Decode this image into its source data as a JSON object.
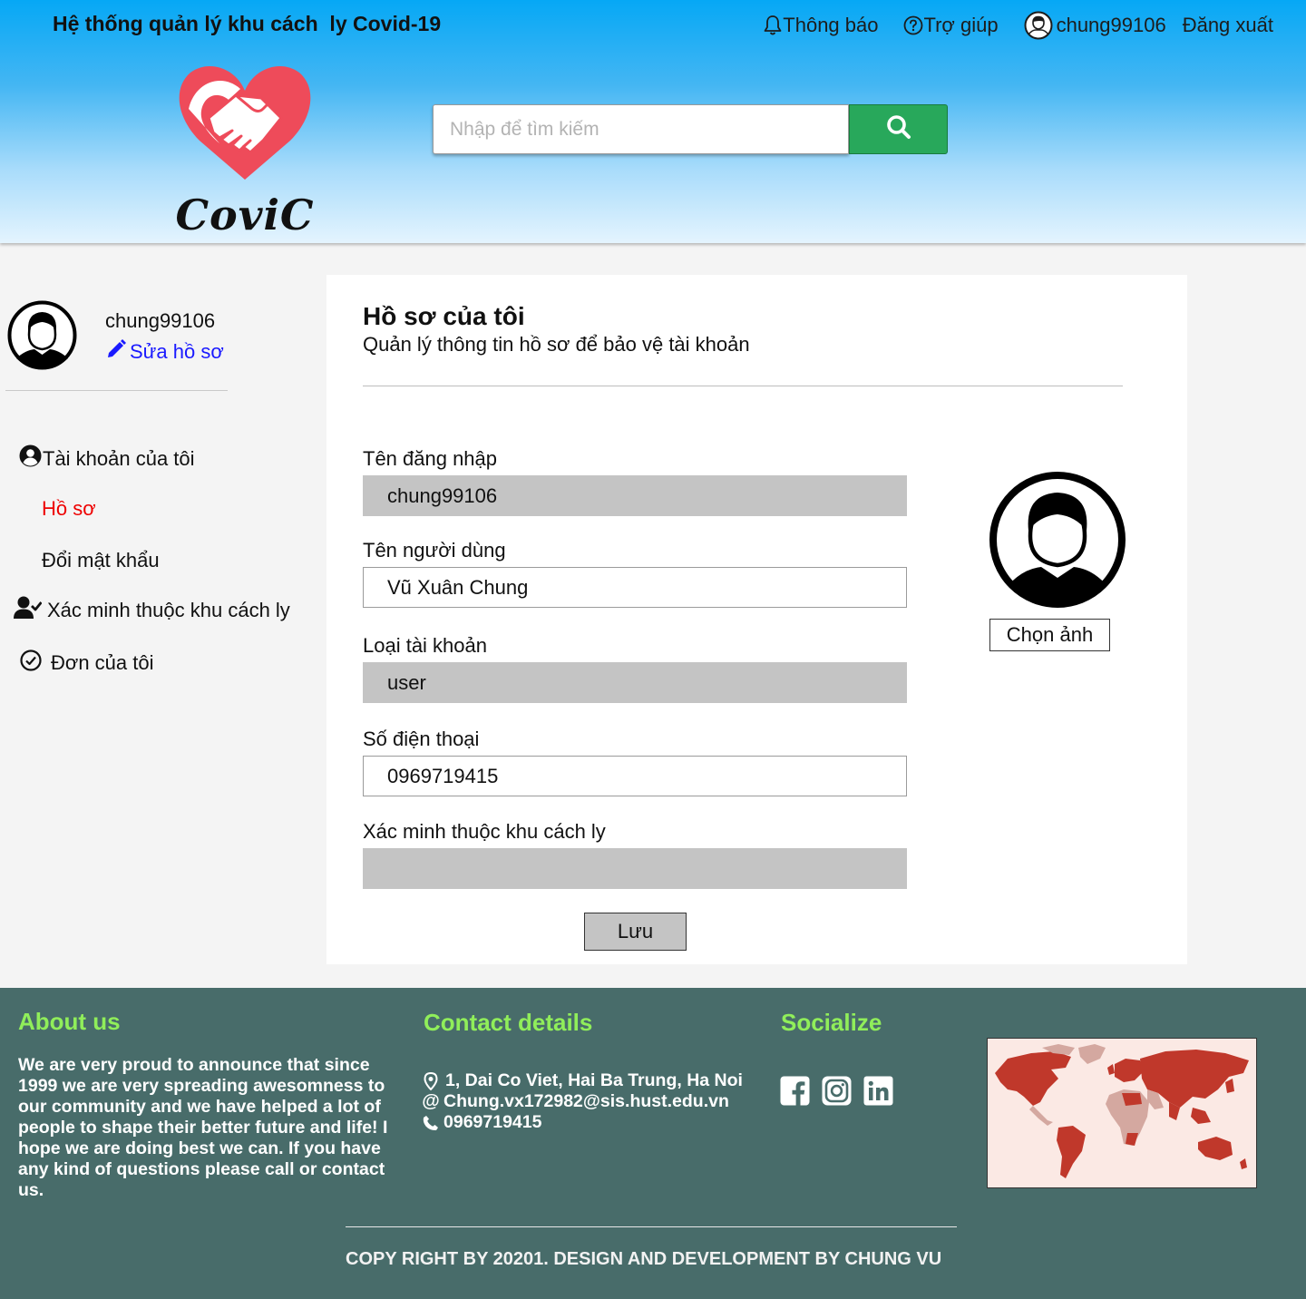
{
  "header": {
    "app_title": "Hệ thống quản lý khu cách  ly Covid-19",
    "nav": {
      "notifications": "Thông báo",
      "help": "Trợ giúp",
      "username": "chung99106",
      "logout": "Đăng xuất"
    },
    "logo_text": "CoviC",
    "search": {
      "placeholder": "Nhập để tìm kiếm",
      "value": "",
      "button_icon": "search-icon"
    }
  },
  "sidebar": {
    "username": "chung99106",
    "edit_profile": "Sửa hồ sơ",
    "menu": [
      {
        "label": "Tài khoản của tôi",
        "icon": "user-circle-icon"
      },
      {
        "label": "Hồ sơ",
        "active": true
      },
      {
        "label": "Đổi mật khẩu"
      },
      {
        "label": "Xác minh thuộc khu cách ly",
        "icon": "user-check-icon"
      },
      {
        "label": "Đơn của tôi",
        "icon": "check-circle-icon"
      }
    ]
  },
  "profile": {
    "title": "Hồ sơ của tôi",
    "subtitle": "Quản lý thông tin hồ sơ để bảo vệ tài khoản",
    "fields": [
      {
        "label": "Tên đăng nhập",
        "value": "chung99106",
        "readonly": true
      },
      {
        "label": "Tên người dùng",
        "value": "Vũ Xuân Chung",
        "readonly": false
      },
      {
        "label": "Loại tài khoản",
        "value": "user",
        "readonly": true
      },
      {
        "label": "Số điện thoại",
        "value": "0969719415",
        "readonly": false
      },
      {
        "label": "Xác minh thuộc khu cách ly",
        "value": "",
        "readonly": true
      }
    ],
    "choose_photo": "Chọn ảnh",
    "save": "Lưu"
  },
  "footer": {
    "about": {
      "heading": "About us",
      "text": "We are very proud to announce that since 1999 we are very spreading awesomness to our community and we have helped a lot of people to shape their better future and life! I hope we are doing best we can. If you have any kind of questions please call or contact us."
    },
    "contact": {
      "heading": "Contact details",
      "address": "1, Dai Co Viet, Hai Ba Trung, Ha Noi",
      "email": "Chung.vx172982@sis.hust.edu.vn",
      "phone": "0969719415"
    },
    "social": {
      "heading": "Socialize",
      "icons": [
        "facebook-icon",
        "instagram-icon",
        "linkedin-icon"
      ]
    },
    "copyright": "COPY RIGHT BY 20201. DESIGN AND DEVELOPMENT BY CHUNG VU"
  },
  "colors": {
    "header_top": "#06a8f5",
    "search_button": "#28a85b",
    "footer_bg": "#486c6a",
    "footer_heading": "#90ee5a",
    "active_menu": "#ee0000",
    "link": "#1a1aff",
    "readonly_field": "#c4c4c4",
    "logo_heart": "#ee4b5a"
  }
}
